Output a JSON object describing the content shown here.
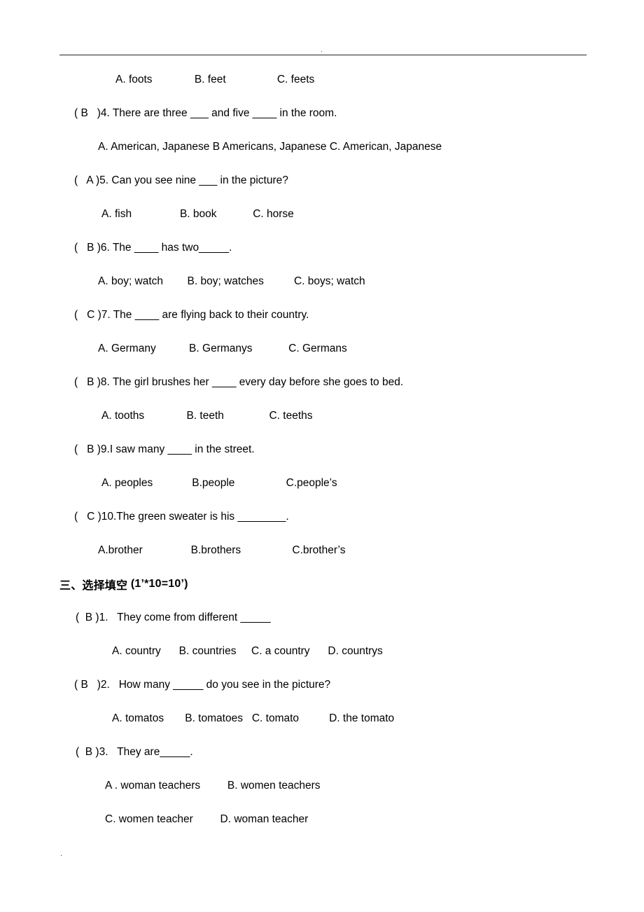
{
  "page": {
    "header_mark": ".",
    "footer_mark": "."
  },
  "section_two_tail": {
    "q3_options": "A. foots              B. feet                 C. feets",
    "questions": [
      {
        "marker": "( B   )4.",
        "stem": "( B   )4. There are three ___ and five ____ in the room.",
        "options": "A. American, Japanese B Americans, Japanese C. American, Japanese"
      },
      {
        "marker": "(   A )5.",
        "stem": "(   A )5. Can you see nine ___ in the picture?",
        "options": "A. fish                B. book            C. horse"
      },
      {
        "marker": "(   B )6.",
        "stem": "(   B )6. The ____ has two_____.",
        "options": "A. boy; watch        B. boy; watches          C. boys; watch"
      },
      {
        "marker": "(   C )7.",
        "stem": "(   C )7. The ____ are flying back to their country.",
        "options": "A. Germany           B. Germanys            C. Germans"
      },
      {
        "marker": "(   B )8.",
        "stem": "(   B )8. The girl brushes her ____ every day before she goes to bed.",
        "options": "A. tooths              B. teeth               C. teeths"
      },
      {
        "marker": "(   B )9.",
        "stem": "(   B )9.I saw many ____ in the street.",
        "options": "A. peoples             B.people                 C.people’s"
      },
      {
        "marker": "(   C )10.",
        "stem": "(   C )10.The green sweater is his ________.",
        "options": "A.brother                B.brothers                 C.brother’s"
      }
    ]
  },
  "section_three": {
    "heading_cn": "三、选择填空",
    "heading_score": " (1’*10=10’)",
    "questions": [
      {
        "marker": "(  B )1.",
        "stem": "(  B )1.   They come from different _____",
        "options": "A. country      B. countries     C. a country      D. countrys"
      },
      {
        "marker": "( B   )2.",
        "stem": "( B   )2.   How many _____ do you see in the picture?",
        "options": "A. tomatos       B. tomatoes   C. tomato          D. the tomato"
      },
      {
        "marker": "(  B )3.",
        "stem": "(  B )3.   They are_____.",
        "options_row1": "A . woman teachers         B. women teachers",
        "options_row2": "C. women teacher         D. woman teacher"
      }
    ]
  }
}
